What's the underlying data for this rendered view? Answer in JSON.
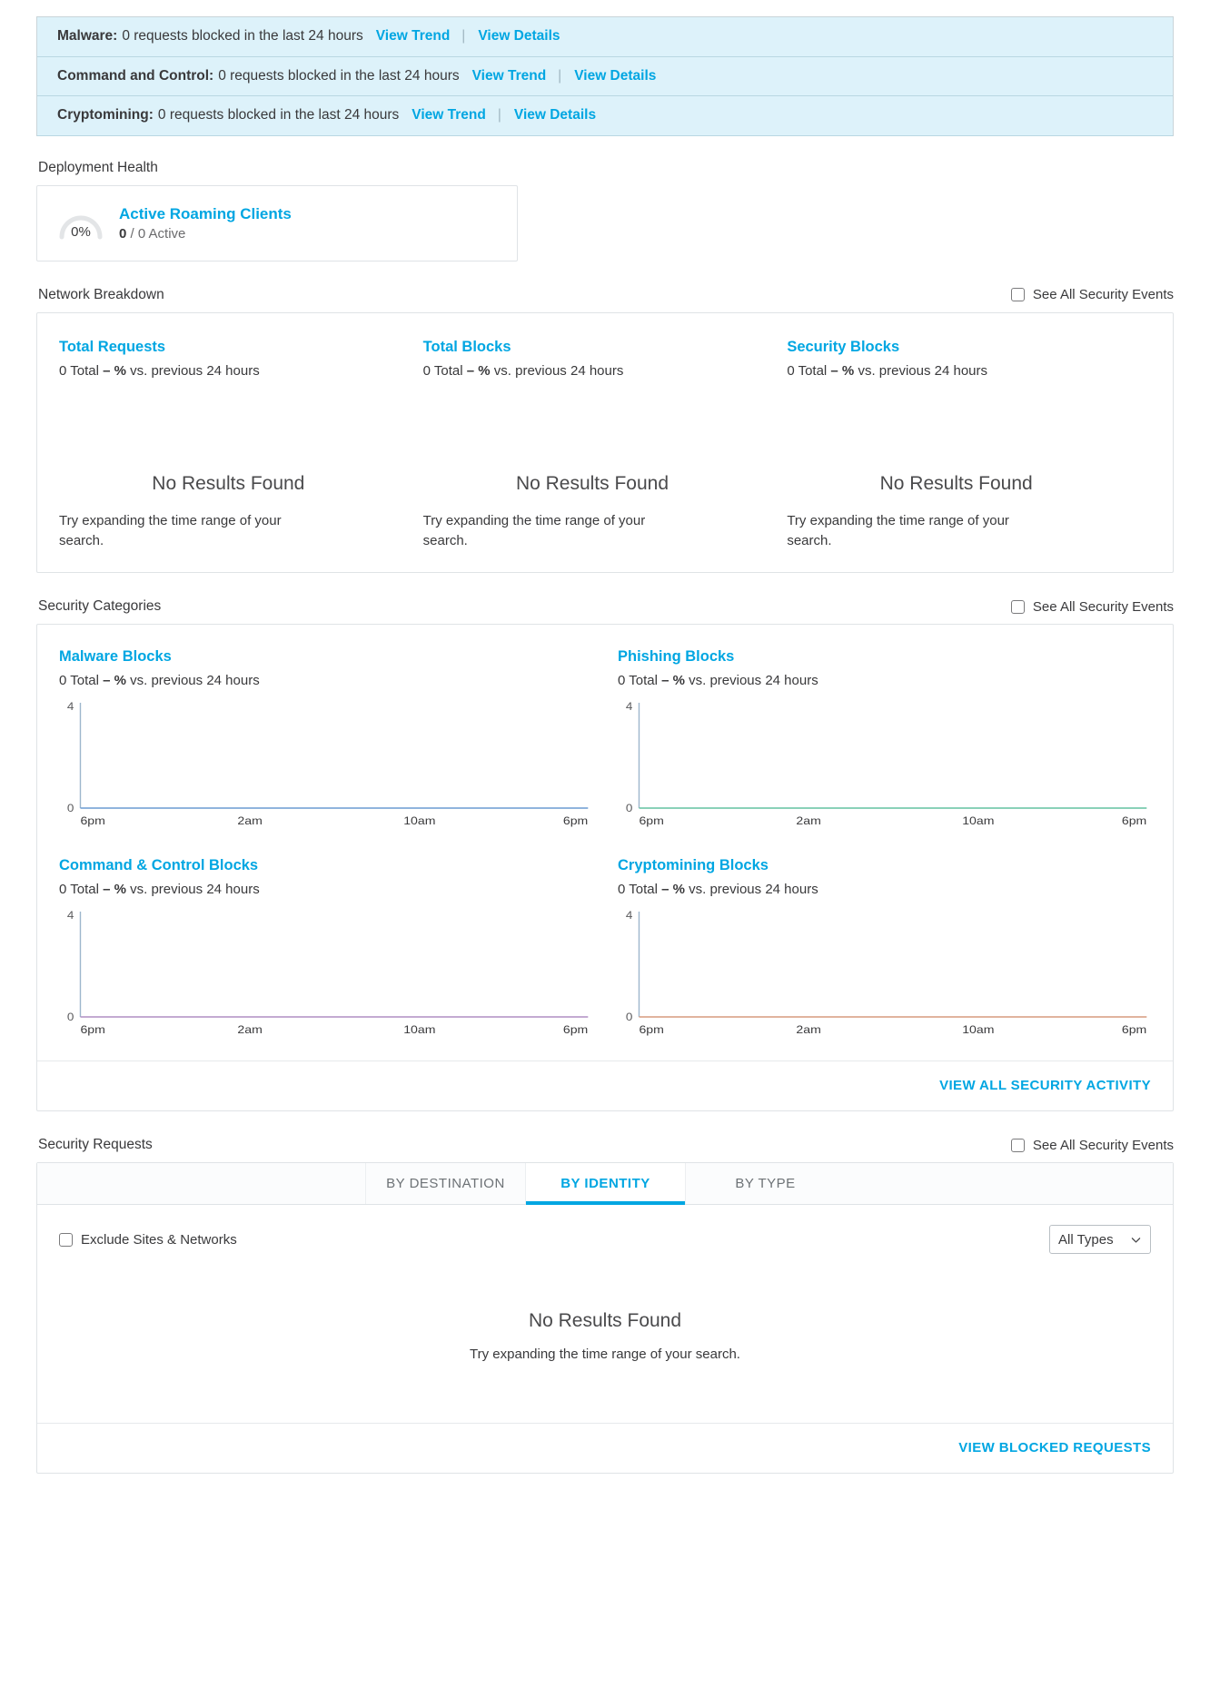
{
  "colors": {
    "accent": "#00a6e2",
    "alert_bg": "#ddf2fa",
    "text": "#39393b"
  },
  "alerts": [
    {
      "label": "Malware:",
      "text": "0 requests blocked in the last 24 hours",
      "trend": "View Trend",
      "sep": "|",
      "details": "View Details"
    },
    {
      "label": "Command and Control:",
      "text": "0 requests blocked in the last 24 hours",
      "trend": "View Trend",
      "sep": "|",
      "details": "View Details"
    },
    {
      "label": "Cryptomining:",
      "text": "0 requests blocked in the last 24 hours",
      "trend": "View Trend",
      "sep": "|",
      "details": "View Details"
    }
  ],
  "deployment_health": {
    "section_label": "Deployment Health",
    "card": {
      "percent": "0%",
      "title": "Active Roaming Clients",
      "value": "0",
      "divider": "/",
      "suffix": "0 Active"
    }
  },
  "network_breakdown": {
    "section_label": "Network Breakdown",
    "see_all_label": "See All Security Events",
    "columns": [
      {
        "title": "Total Requests",
        "sub_pre": "0 Total ",
        "sub_bold": "– %",
        "sub_post": " vs. previous 24 hours",
        "empty_title": "No Results Found",
        "empty_sub": "Try expanding the time range of your search."
      },
      {
        "title": "Total Blocks",
        "sub_pre": "0 Total ",
        "sub_bold": "– %",
        "sub_post": " vs. previous 24 hours",
        "empty_title": "No Results Found",
        "empty_sub": "Try expanding the time range of your search."
      },
      {
        "title": "Security Blocks",
        "sub_pre": "0 Total ",
        "sub_bold": "– %",
        "sub_post": " vs. previous 24 hours",
        "empty_title": "No Results Found",
        "empty_sub": "Try expanding the time range of your search."
      }
    ]
  },
  "security_categories": {
    "section_label": "Security Categories",
    "see_all_label": "See All Security Events",
    "footer_link": "VIEW ALL SECURITY ACTIVITY",
    "charts": [
      {
        "title": "Malware Blocks",
        "sub_pre": "0 Total ",
        "sub_bold": "– %",
        "sub_post": " vs. previous 24 hours",
        "line_color": "#6b9bd2"
      },
      {
        "title": "Phishing Blocks",
        "sub_pre": "0 Total ",
        "sub_bold": "– %",
        "sub_post": " vs. previous 24 hours",
        "line_color": "#63c2a0"
      },
      {
        "title": "Command & Control Blocks",
        "sub_pre": "0 Total ",
        "sub_bold": "– %",
        "sub_post": " vs. previous 24 hours",
        "line_color": "#b08ec4"
      },
      {
        "title": "Cryptomining Blocks",
        "sub_pre": "0 Total ",
        "sub_bold": "– %",
        "sub_post": " vs. previous 24 hours",
        "line_color": "#d79a7e"
      }
    ]
  },
  "chart_data": [
    {
      "type": "line",
      "title": "Malware Blocks",
      "x": [
        "6pm",
        "2am",
        "10am",
        "6pm"
      ],
      "xtick_labels": [
        "6pm",
        "2am",
        "10am",
        "6pm"
      ],
      "ytick_labels": [
        "0",
        "4"
      ],
      "ylim": [
        0,
        4
      ],
      "values": [
        0,
        0,
        0,
        0
      ],
      "total": 0,
      "change_pct": null,
      "xlabel": "",
      "ylabel": "",
      "grid": false,
      "legend": "none"
    },
    {
      "type": "line",
      "title": "Phishing Blocks",
      "x": [
        "6pm",
        "2am",
        "10am",
        "6pm"
      ],
      "xtick_labels": [
        "6pm",
        "2am",
        "10am",
        "6pm"
      ],
      "ytick_labels": [
        "0",
        "4"
      ],
      "ylim": [
        0,
        4
      ],
      "values": [
        0,
        0,
        0,
        0
      ],
      "total": 0,
      "change_pct": null,
      "xlabel": "",
      "ylabel": "",
      "grid": false,
      "legend": "none"
    },
    {
      "type": "line",
      "title": "Command & Control Blocks",
      "x": [
        "6pm",
        "2am",
        "10am",
        "6pm"
      ],
      "xtick_labels": [
        "6pm",
        "2am",
        "10am",
        "6pm"
      ],
      "ytick_labels": [
        "0",
        "4"
      ],
      "ylim": [
        0,
        4
      ],
      "values": [
        0,
        0,
        0,
        0
      ],
      "total": 0,
      "change_pct": null,
      "xlabel": "",
      "ylabel": "",
      "grid": false,
      "legend": "none"
    },
    {
      "type": "line",
      "title": "Cryptomining Blocks",
      "x": [
        "6pm",
        "2am",
        "10am",
        "6pm"
      ],
      "xtick_labels": [
        "6pm",
        "2am",
        "10am",
        "6pm"
      ],
      "ytick_labels": [
        "0",
        "4"
      ],
      "ylim": [
        0,
        4
      ],
      "values": [
        0,
        0,
        0,
        0
      ],
      "total": 0,
      "change_pct": null,
      "xlabel": "",
      "ylabel": "",
      "grid": false,
      "legend": "none"
    }
  ],
  "security_requests": {
    "section_label": "Security Requests",
    "see_all_label": "See All Security Events",
    "tabs": [
      {
        "label": "BY DESTINATION",
        "active": false
      },
      {
        "label": "BY IDENTITY",
        "active": true
      },
      {
        "label": "BY TYPE",
        "active": false
      }
    ],
    "exclude_label": "Exclude Sites & Networks",
    "types_select": "All Types",
    "empty_title": "No Results Found",
    "empty_sub": "Try expanding the time range of your search.",
    "footer_link": "VIEW BLOCKED REQUESTS"
  }
}
